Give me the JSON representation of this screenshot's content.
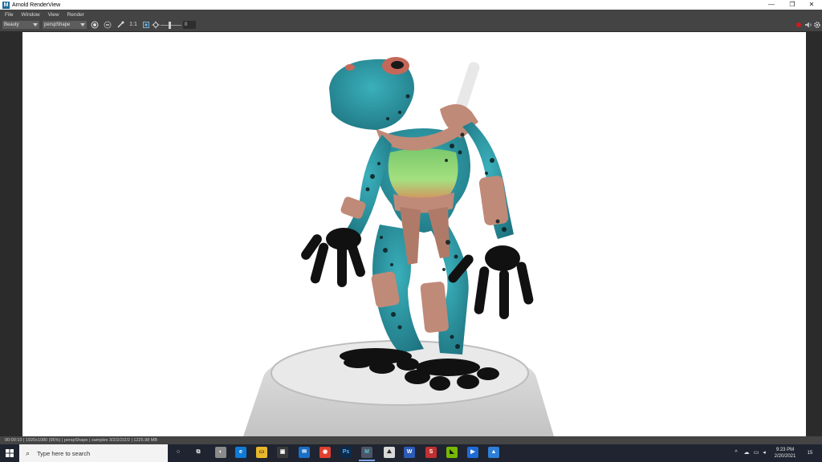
{
  "window": {
    "title": "Arnold RenderView",
    "minimize": "—",
    "restore": "❐",
    "close": "✕"
  },
  "menu": [
    "File",
    "Window",
    "View",
    "Render"
  ],
  "toolbar": {
    "aov_select": "Beauty",
    "camera_select": "perspShape",
    "ratio_label": "1:1",
    "exposure_value": "0"
  },
  "status": {
    "text": "00:00:10 | 1920x1080 (95%) | perspShape | samples 3/2/2/2/2/2 | 1225.98 MB"
  },
  "taskbar": {
    "search_placeholder": "Type here to search",
    "apps": [
      {
        "name": "cortana",
        "glyph": "○"
      },
      {
        "name": "task-view",
        "glyph": "⧉"
      },
      {
        "name": "app-1",
        "glyph": "◐"
      },
      {
        "name": "edge",
        "glyph": "e"
      },
      {
        "name": "file-explorer",
        "glyph": "▭"
      },
      {
        "name": "store",
        "glyph": "▣"
      },
      {
        "name": "mail",
        "glyph": "✉"
      },
      {
        "name": "chrome",
        "glyph": "◉"
      },
      {
        "name": "photoshop",
        "glyph": "Ps"
      },
      {
        "name": "maya",
        "glyph": "M"
      },
      {
        "name": "app-2",
        "glyph": "⛰"
      },
      {
        "name": "word",
        "glyph": "W"
      },
      {
        "name": "app-3",
        "glyph": "S"
      },
      {
        "name": "nvidia",
        "glyph": "◣"
      },
      {
        "name": "app-4",
        "glyph": "▶"
      },
      {
        "name": "photos",
        "glyph": "▲"
      }
    ],
    "time": "9:23 PM",
    "date": "2/20/2021",
    "notification_count": "15"
  },
  "colors": {
    "accent": "#1d6b9a",
    "frog_skin": "#2f9aa6",
    "frog_spots": "#0d1c1e",
    "frog_belly": "#8ad47a",
    "leather": "#c08a78",
    "pedestal": "#d7d7d7",
    "record_button": "#d01b1b"
  }
}
